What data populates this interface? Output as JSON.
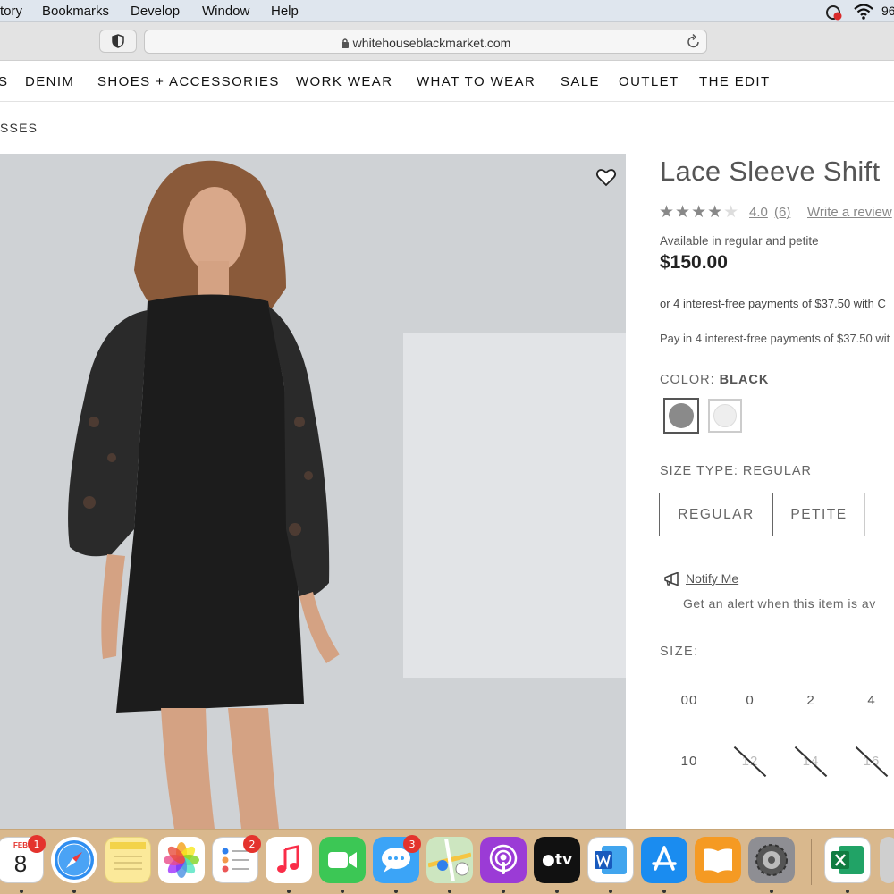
{
  "menubar": {
    "items": [
      "tory",
      "Bookmarks",
      "Develop",
      "Window",
      "Help"
    ],
    "status_text": "96"
  },
  "browser": {
    "url": "whitehouseblackmarket.com"
  },
  "sitenav": {
    "items": [
      "S",
      "DENIM",
      "SHOES + ACCESSORIES",
      "WORK WEAR",
      "WHAT TO WEAR",
      "SALE",
      "OUTLET",
      "THE EDIT"
    ]
  },
  "breadcrumb": "SSES",
  "product": {
    "title": "Lace Sleeve Shift",
    "stars_filled": "★★★★",
    "stars_empty": "★",
    "rating": "4.0",
    "review_count": "(6)",
    "write_review": "Write a review",
    "availability": "Available in regular and petite",
    "price": "$150.00",
    "payment_line1": "or 4 interest-free payments of $37.50 with C",
    "payment_line2": "Pay in 4 interest-free payments of $37.50 wit",
    "color_label": "COLOR:",
    "color_value": "BLACK",
    "size_type_label": "SIZE TYPE: REGULAR",
    "size_type_options": [
      "REGULAR",
      "PETITE"
    ],
    "notify_label": "Notify Me",
    "alert_text": "Get an alert when this item is av",
    "size_label": "SIZE:",
    "sizes_row1": [
      "00",
      "0",
      "2",
      "4"
    ],
    "sizes_row2": [
      "10",
      "12",
      "14",
      "16"
    ]
  },
  "dock": {
    "calendar_month": "FEB",
    "calendar_day": "8",
    "badges": {
      "calendar": "1",
      "reminders": "2",
      "messages": "3"
    },
    "appletv_label": "tv"
  },
  "colors": {
    "accent_swatch_black": "#8a8a8a",
    "dock_bg": "#d9b88d",
    "badge": "#e4332d"
  }
}
